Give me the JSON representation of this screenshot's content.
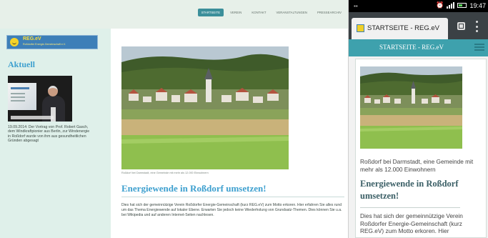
{
  "desktop": {
    "nav": [
      {
        "label": "STARTSEITE",
        "active": true
      },
      {
        "label": "VEREIN",
        "active": false
      },
      {
        "label": "KONTAKT",
        "active": false
      },
      {
        "label": "VERANSTALTUNGEN",
        "active": false
      },
      {
        "label": "PRESSEARCHIV",
        "active": false
      }
    ],
    "sidebar": {
      "logo_name": "REG.eV",
      "logo_tagline": "Roßdorfer Energie-Gemeinschaft e.V.",
      "heading": "Aktuell",
      "news_text": "19.09.2014: Der Vortrag von Prof. Robert Gasch, dem Windkraftpionier aus Berlin, zur Windenergie in Roßdorf wurde von ihm aus gesundheitlichen Gründen abgesagt"
    },
    "main": {
      "photo_caption": "Roßdorf bei Darmstadt, eine Gemeinde mit mehr als 12.000 Einwohnern",
      "article_title": "Energiewende in Roßdorf umsetzen!",
      "article_text": "Dies hat sich der gemeinnützige Verein Roßdorfer Energie-Gemeinschaft (kurz REG.eV) zum Motto erkoren. Hier erfahren Sie alles rund um das Thema Energiewende auf lokaler Ebene. Erwarten Sie jedoch keine Wiederholung von Grundsatz-Themen. Dies können Sie u.a. bei Wikipedia und auf anderen Internet-Seiten nachlesen."
    }
  },
  "phone": {
    "status_time": "19:47",
    "tab_title": "STARTSEITE - REG.eV",
    "header_title": "STARTSEITE - REG.eV",
    "photo_caption": "Roßdorf bei Darmstadt, eine Gemeinde mit mehr als 12.000 Einwohnern",
    "article_title": "Energiewende in Roßdorf umsetzen!",
    "article_text": "Dies hat sich der gemeinnützige Verein Roßdorfer Energie-Gemeinschaft (kurz REG.eV) zum Motto erkoren. Hier"
  },
  "colors": {
    "accent": "#3ea0cf",
    "header_teal": "#3ea1ad",
    "sidebar_bg": "#dff0ea"
  },
  "icons": [
    "sun-logo-icon",
    "tabs-icon",
    "overflow-menu-icon",
    "hamburger-menu-icon",
    "signal-icon",
    "battery-icon",
    "alarm-icon"
  ]
}
